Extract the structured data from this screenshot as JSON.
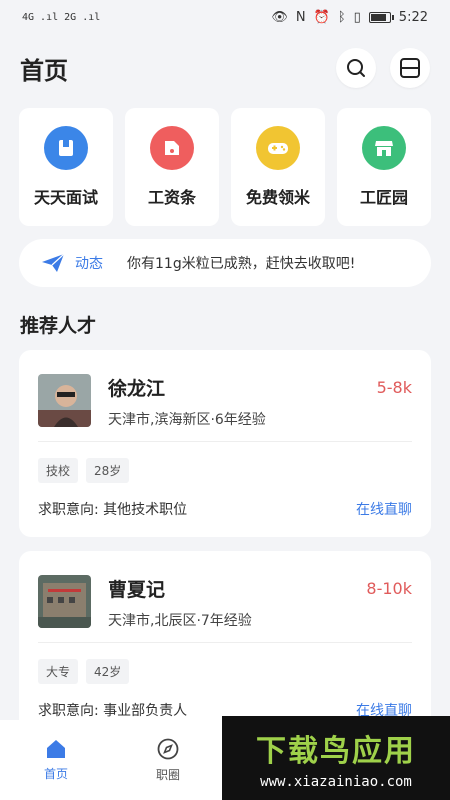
{
  "status_bar": {
    "left": "4G .ıl 2G .ıl",
    "time": "5:22"
  },
  "header": {
    "title": "首页"
  },
  "quick_actions": [
    {
      "label": "天天面试",
      "color": "#3b86e8"
    },
    {
      "label": "工资条",
      "color": "#ef5e5e"
    },
    {
      "label": "免费领米",
      "color": "#f1c532"
    },
    {
      "label": "工匠园",
      "color": "#3cbf7b"
    }
  ],
  "notice": {
    "tag": "动态",
    "text": "你有11g米粒已成熟，赶快去收取吧!"
  },
  "section": {
    "title": "推荐人才"
  },
  "candidates": [
    {
      "name": "徐龙江",
      "salary": "5-8k",
      "meta": "天津市,滨海新区·6年经验",
      "tags": [
        "技校",
        "28岁"
      ],
      "intent_label": "求职意向:",
      "intent_value": "其他技术职位",
      "chat": "在线直聊"
    },
    {
      "name": "曹夏记",
      "salary": "8-10k",
      "meta": "天津市,北辰区·7年经验",
      "tags": [
        "大专",
        "42岁"
      ],
      "intent_label": "求职意向:",
      "intent_value": "事业部负责人",
      "chat": "在线直聊"
    }
  ],
  "tabbar": [
    {
      "label": "首页"
    },
    {
      "label": "职圈"
    }
  ],
  "watermark": {
    "title": "下载鸟应用",
    "url": "www.xiazainiao.com"
  }
}
